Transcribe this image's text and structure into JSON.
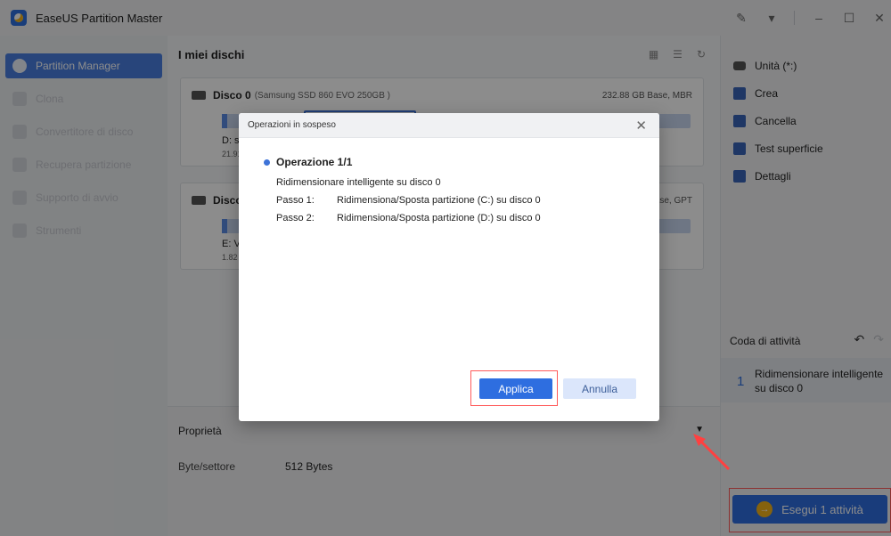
{
  "titlebar": {
    "app_title": "EaseUS Partition Master"
  },
  "sidebar": {
    "items": [
      {
        "label": "Partition Manager"
      },
      {
        "label": "Clona"
      },
      {
        "label": "Convertitore di disco"
      },
      {
        "label": "Recupera partizione"
      },
      {
        "label": "Supporto di avvio"
      },
      {
        "label": "Strumenti"
      }
    ]
  },
  "main": {
    "title": "I miei dischi",
    "disks": [
      {
        "name": "Disco 0",
        "model": "(Samsung SSD 860 EVO 250GB )",
        "info": "232.88 GB Base, MBR",
        "partition_label": "D: si",
        "partition_size": "21.91"
      },
      {
        "name": "Disco",
        "info": "Base, GPT",
        "partition_label": "E: Vo",
        "partition_size": "1.82"
      }
    ]
  },
  "properties": {
    "title": "Proprietà",
    "toggle_icon": "▼",
    "key": "Byte/settore",
    "value": "512 Bytes"
  },
  "actions": {
    "items": [
      {
        "label": "Unità (*:)",
        "icon": "disk-icon"
      },
      {
        "label": "Crea",
        "icon": "create-icon"
      },
      {
        "label": "Cancella",
        "icon": "eraser-icon"
      },
      {
        "label": "Test superficie",
        "icon": "surface-test-icon"
      },
      {
        "label": "Dettagli",
        "icon": "details-icon"
      }
    ]
  },
  "queue": {
    "title": "Coda di attività",
    "item_number": "1",
    "item_text": "Ridimensionare intelligente su disco 0",
    "execute_label": "Esegui 1 attività"
  },
  "dialog": {
    "title": "Operazioni in sospeso",
    "operation_title": "Operazione 1/1",
    "operation_desc": "Ridimensionare intelligente su disco 0",
    "steps": [
      {
        "label": "Passo 1:",
        "text": "Ridimensiona/Sposta partizione (C:) su disco 0"
      },
      {
        "label": "Passo 2:",
        "text": "Ridimensiona/Sposta partizione (D:) su disco 0"
      }
    ],
    "apply_label": "Applica",
    "cancel_label": "Annulla"
  },
  "colors": {
    "accent": "#2e6ee0",
    "highlight_box": "#ff5a5a",
    "execute_arrow": "#f2b21b"
  }
}
